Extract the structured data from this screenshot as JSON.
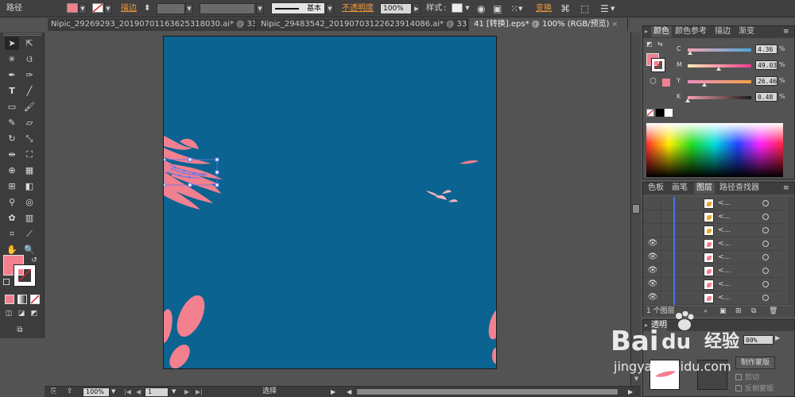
{
  "control_bar": {
    "object_type": "路径",
    "stroke_label": "描边",
    "stroke_profile": "基本",
    "opacity_label": "不透明度",
    "opacity_value": "100%",
    "style_label": "样式",
    "transform_label": "变换",
    "fill_color": "#f2808f"
  },
  "tabs": [
    {
      "label": "Nipic_29269293_20190701163625318030.ai* @ 33...",
      "close": "×"
    },
    {
      "label": "Nipic_29483542_20190703122623914086.ai* @ 33...",
      "close": "×"
    },
    {
      "label": "41 [转换].eps* @ 100% (RGB/预览)",
      "close": "×"
    }
  ],
  "status_bar": {
    "zoom": "100%",
    "artboard_number": "1",
    "tool_name": "选择"
  },
  "color_panel": {
    "tabs": [
      "颜色",
      "颜色参考",
      "描边",
      "渐变"
    ],
    "channels": [
      {
        "label": "C",
        "value": "4.36",
        "position": 0.04,
        "gradient": "linear-gradient(90deg,#f4a4b4,#4da7d9)"
      },
      {
        "label": "M",
        "value": "49.03",
        "position": 0.49,
        "gradient": "linear-gradient(90deg,#fcecb8,#ea3c8f)"
      },
      {
        "label": "Y",
        "value": "26.46",
        "position": 0.26,
        "gradient": "linear-gradient(90deg,#f08cc0,#f2a14a)"
      },
      {
        "label": "K",
        "value": "0.48",
        "position": 0.005,
        "gradient": "linear-gradient(90deg,#f4a0ae,#1a1a1a)"
      }
    ],
    "fill_color": "#f2808f"
  },
  "layers_panel": {
    "tabs": [
      "色板",
      "画笔",
      "图层",
      "路径查找器"
    ],
    "rows": [
      {
        "name": "<...",
        "visible": false,
        "thumb_color": "#e6a830"
      },
      {
        "name": "<...",
        "visible": false,
        "thumb_color": "#e6a830"
      },
      {
        "name": "<...",
        "visible": false,
        "thumb_color": "#e6a830"
      },
      {
        "name": "<...",
        "visible": true,
        "thumb_color": "#f2808f"
      },
      {
        "name": "<...",
        "visible": true,
        "thumb_color": "#f2808f"
      },
      {
        "name": "<...",
        "visible": true,
        "thumb_color": "#f2808f"
      },
      {
        "name": "<...",
        "visible": true,
        "thumb_color": "#f2808f"
      },
      {
        "name": "<...",
        "visible": true,
        "thumb_color": "#f2808f"
      }
    ],
    "layer_count": "1 个图层"
  },
  "transparency_panel": {
    "title": "透明",
    "opacity_partial": "00%",
    "make_mask_button": "制作蒙版",
    "clip_label": "剪切",
    "invert_mask_label": "反相蒙版"
  },
  "watermark": {
    "brand": "Bai",
    "cn": "经验",
    "url": "jingyan.baidu.com"
  },
  "colors": {
    "canvas_bg": "#0b6391",
    "accent_pink": "#f2808f",
    "selection_blue": "#5a78f0"
  }
}
